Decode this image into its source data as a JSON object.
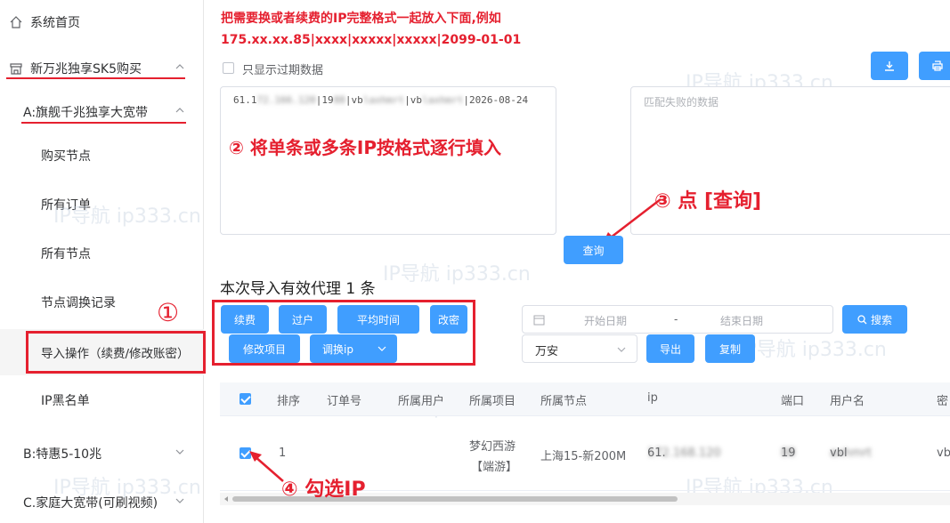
{
  "sidebar": {
    "home": "系统首页",
    "sk5": "新万兆独享SK5购买",
    "flagship": "A:旗舰千兆独享大宽带",
    "items": [
      "购买节点",
      "所有订单",
      "所有节点",
      "节点调换记录",
      "导入操作（续费/修改账密）",
      "IP黑名单"
    ],
    "special": "B:特惠5-10兆",
    "family": "C.家庭大宽带(可刷视频)"
  },
  "notice": {
    "line1": "把需要换或者续费的IP完整格式一起放入下面,例如",
    "line2": "175.xx.xx.85|xxxx|xxxxx|xxxxx|2099-01-01"
  },
  "only_expired": "只显示过期数据",
  "input_text": {
    "prefix": "61.1",
    "blur1": "72.166.120",
    "sep1": "|19",
    "blur2": "88",
    "sep2": "|vb",
    "blur3": "laxhmrt",
    "sep3": "|vb",
    "blur4": "laxhmrt",
    "suffix": "|2026-08-24"
  },
  "fail_placeholder": "匹配失败的数据",
  "query_button": "查询",
  "annotations": {
    "a1": "①",
    "a2": "② 将单条或多条IP按格式逐行填入",
    "a3": "③ 点 [查询]",
    "a4": "④ 勾选IP"
  },
  "valid_count": "本次导入有效代理 1 条",
  "actions": {
    "renew": "续费",
    "transfer": "过户",
    "avg_time": "平均时间",
    "change_pwd": "改密",
    "modify_project": "修改项目",
    "swap_ip": "调换ip"
  },
  "filters": {
    "start_date": "开始日期",
    "dash": "-",
    "end_date": "结束日期",
    "search": "搜索",
    "region": "万安",
    "export": "导出",
    "copy": "复制"
  },
  "table": {
    "headers": [
      "排序",
      "订单号",
      "所属用户",
      "所属项目",
      "所属节点",
      "ip",
      "端口",
      "用户名",
      "密"
    ],
    "row": {
      "index": "1",
      "project_line1": "梦幻西游",
      "project_line2": "【端游】",
      "node": "上海15-新200M",
      "ip_prefix": "61.",
      "ip_blur": "172.168.120",
      "port_prefix": "19",
      "port_blur": "88",
      "user_prefix": "vbl",
      "user_blur": "axhmrt",
      "pwd_prefix": "vb"
    }
  },
  "watermark": "IP导航  ip333.cn",
  "colors": {
    "primary": "#409eff",
    "annotation": "#e5202f"
  }
}
